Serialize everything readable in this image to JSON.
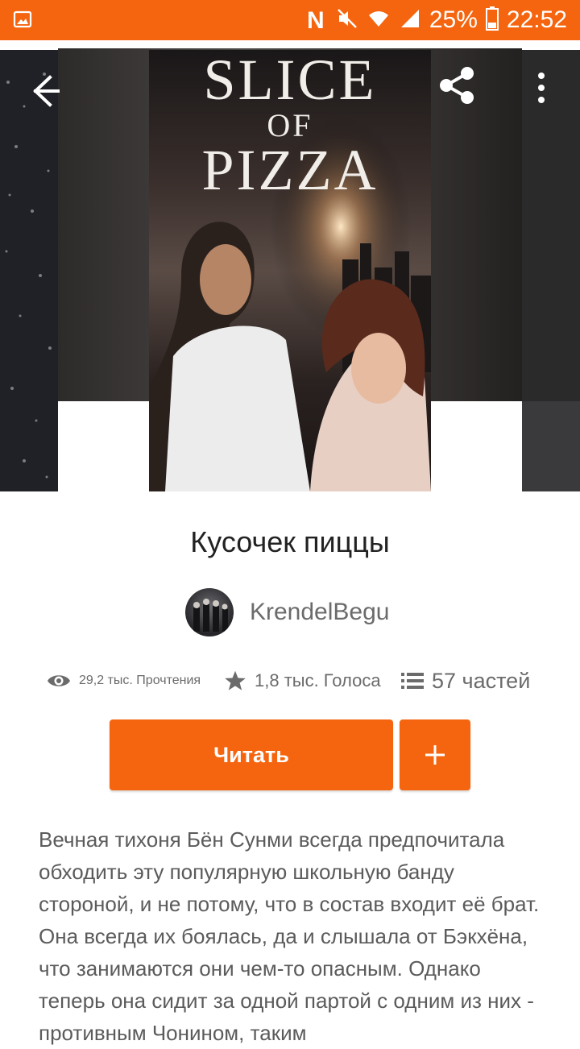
{
  "status_bar": {
    "battery": "25%",
    "time": "22:52",
    "icons": [
      "gallery-icon",
      "nfc-icon",
      "mute-icon",
      "wifi-icon",
      "signal-icon",
      "battery-icon"
    ]
  },
  "cover": {
    "title_line1": "SLICE",
    "title_line2": "OF",
    "title_line3": "PIZZA"
  },
  "story": {
    "title": "Кусочек пиццы",
    "author": "KrendelBegu",
    "reads": "29,2 тыс. Прочтения",
    "votes": "1,8 тыс. Голоса",
    "parts": "57 частей",
    "read_button": "Читать",
    "add_button": "+",
    "description": "Вечная тихоня Бён Сунми всегда предпочитала обходить эту популярную школьную банду стороной, и не потому, что в состав входит её брат. Она всегда их боялась, да и слышала от Бэкхёна, что занимаются они чем-то опасным. Однако теперь она сидит за одной партой с одним из них - противным Чонином, таким"
  },
  "colors": {
    "accent": "#f5650f"
  }
}
